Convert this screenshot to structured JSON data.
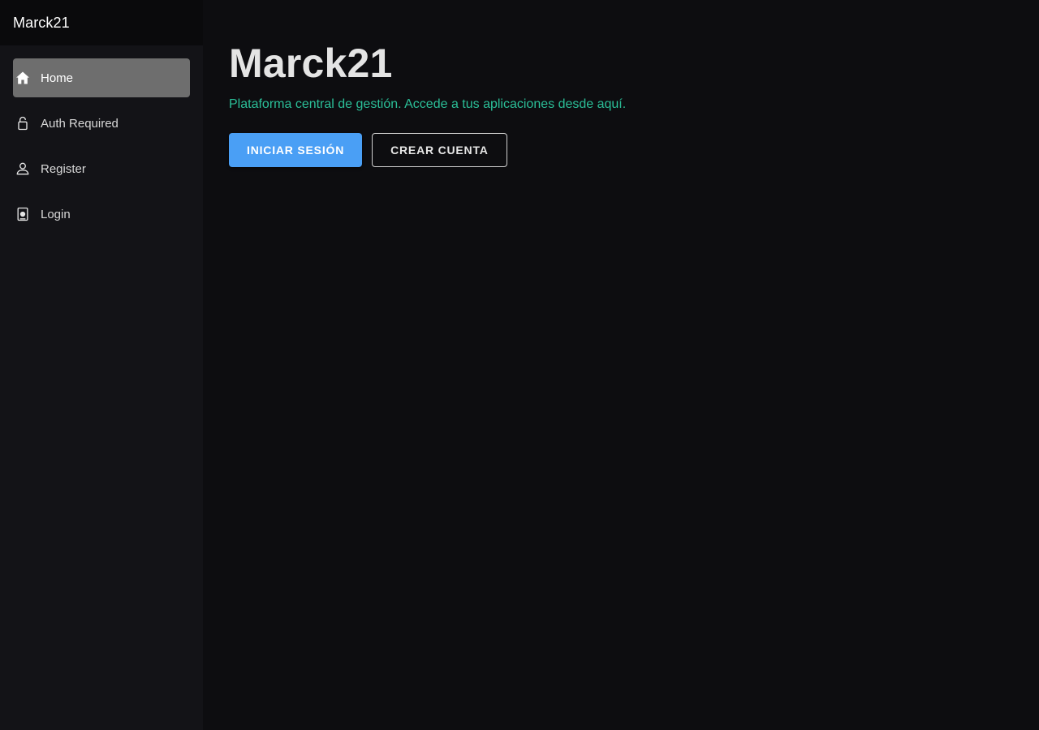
{
  "sidebar": {
    "brand": "Marck21",
    "items": [
      {
        "label": "Home",
        "icon": "home-icon",
        "active": true
      },
      {
        "label": "Auth Required",
        "icon": "lock-icon",
        "active": false
      },
      {
        "label": "Register",
        "icon": "user-icon",
        "active": false
      },
      {
        "label": "Login",
        "icon": "login-badge-icon",
        "active": false
      }
    ]
  },
  "main": {
    "title": "Marck21",
    "subtitle": "Plataforma central de gestión. Accede a tus aplicaciones desde aquí.",
    "primary_button": "INICIAR SESIÓN",
    "secondary_button": "CREAR CUENTA"
  },
  "colors": {
    "accent_primary": "#4a9ff5",
    "subtitle_green": "#2bbf98",
    "active_item": "#6e6e6e"
  }
}
